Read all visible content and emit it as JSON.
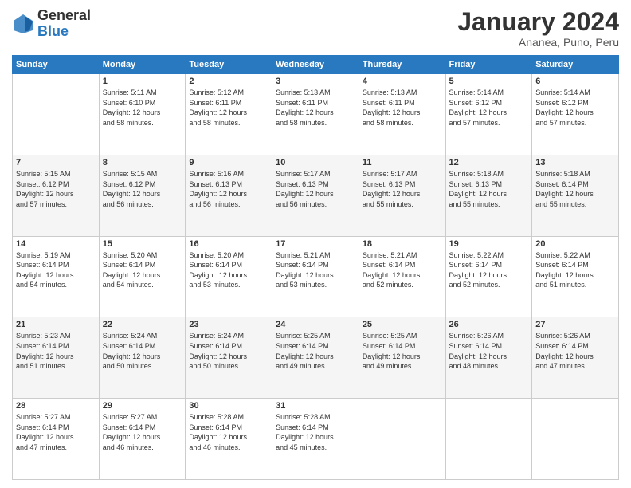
{
  "logo": {
    "general": "General",
    "blue": "Blue"
  },
  "title": {
    "month_year": "January 2024",
    "location": "Ananea, Puno, Peru"
  },
  "headers": [
    "Sunday",
    "Monday",
    "Tuesday",
    "Wednesday",
    "Thursday",
    "Friday",
    "Saturday"
  ],
  "weeks": [
    [
      {
        "num": "",
        "detail": ""
      },
      {
        "num": "1",
        "detail": "Sunrise: 5:11 AM\nSunset: 6:10 PM\nDaylight: 12 hours\nand 58 minutes."
      },
      {
        "num": "2",
        "detail": "Sunrise: 5:12 AM\nSunset: 6:11 PM\nDaylight: 12 hours\nand 58 minutes."
      },
      {
        "num": "3",
        "detail": "Sunrise: 5:13 AM\nSunset: 6:11 PM\nDaylight: 12 hours\nand 58 minutes."
      },
      {
        "num": "4",
        "detail": "Sunrise: 5:13 AM\nSunset: 6:11 PM\nDaylight: 12 hours\nand 58 minutes."
      },
      {
        "num": "5",
        "detail": "Sunrise: 5:14 AM\nSunset: 6:12 PM\nDaylight: 12 hours\nand 57 minutes."
      },
      {
        "num": "6",
        "detail": "Sunrise: 5:14 AM\nSunset: 6:12 PM\nDaylight: 12 hours\nand 57 minutes."
      }
    ],
    [
      {
        "num": "7",
        "detail": "Sunrise: 5:15 AM\nSunset: 6:12 PM\nDaylight: 12 hours\nand 57 minutes."
      },
      {
        "num": "8",
        "detail": "Sunrise: 5:15 AM\nSunset: 6:12 PM\nDaylight: 12 hours\nand 56 minutes."
      },
      {
        "num": "9",
        "detail": "Sunrise: 5:16 AM\nSunset: 6:13 PM\nDaylight: 12 hours\nand 56 minutes."
      },
      {
        "num": "10",
        "detail": "Sunrise: 5:17 AM\nSunset: 6:13 PM\nDaylight: 12 hours\nand 56 minutes."
      },
      {
        "num": "11",
        "detail": "Sunrise: 5:17 AM\nSunset: 6:13 PM\nDaylight: 12 hours\nand 55 minutes."
      },
      {
        "num": "12",
        "detail": "Sunrise: 5:18 AM\nSunset: 6:13 PM\nDaylight: 12 hours\nand 55 minutes."
      },
      {
        "num": "13",
        "detail": "Sunrise: 5:18 AM\nSunset: 6:14 PM\nDaylight: 12 hours\nand 55 minutes."
      }
    ],
    [
      {
        "num": "14",
        "detail": "Sunrise: 5:19 AM\nSunset: 6:14 PM\nDaylight: 12 hours\nand 54 minutes."
      },
      {
        "num": "15",
        "detail": "Sunrise: 5:20 AM\nSunset: 6:14 PM\nDaylight: 12 hours\nand 54 minutes."
      },
      {
        "num": "16",
        "detail": "Sunrise: 5:20 AM\nSunset: 6:14 PM\nDaylight: 12 hours\nand 53 minutes."
      },
      {
        "num": "17",
        "detail": "Sunrise: 5:21 AM\nSunset: 6:14 PM\nDaylight: 12 hours\nand 53 minutes."
      },
      {
        "num": "18",
        "detail": "Sunrise: 5:21 AM\nSunset: 6:14 PM\nDaylight: 12 hours\nand 52 minutes."
      },
      {
        "num": "19",
        "detail": "Sunrise: 5:22 AM\nSunset: 6:14 PM\nDaylight: 12 hours\nand 52 minutes."
      },
      {
        "num": "20",
        "detail": "Sunrise: 5:22 AM\nSunset: 6:14 PM\nDaylight: 12 hours\nand 51 minutes."
      }
    ],
    [
      {
        "num": "21",
        "detail": "Sunrise: 5:23 AM\nSunset: 6:14 PM\nDaylight: 12 hours\nand 51 minutes."
      },
      {
        "num": "22",
        "detail": "Sunrise: 5:24 AM\nSunset: 6:14 PM\nDaylight: 12 hours\nand 50 minutes."
      },
      {
        "num": "23",
        "detail": "Sunrise: 5:24 AM\nSunset: 6:14 PM\nDaylight: 12 hours\nand 50 minutes."
      },
      {
        "num": "24",
        "detail": "Sunrise: 5:25 AM\nSunset: 6:14 PM\nDaylight: 12 hours\nand 49 minutes."
      },
      {
        "num": "25",
        "detail": "Sunrise: 5:25 AM\nSunset: 6:14 PM\nDaylight: 12 hours\nand 49 minutes."
      },
      {
        "num": "26",
        "detail": "Sunrise: 5:26 AM\nSunset: 6:14 PM\nDaylight: 12 hours\nand 48 minutes."
      },
      {
        "num": "27",
        "detail": "Sunrise: 5:26 AM\nSunset: 6:14 PM\nDaylight: 12 hours\nand 47 minutes."
      }
    ],
    [
      {
        "num": "28",
        "detail": "Sunrise: 5:27 AM\nSunset: 6:14 PM\nDaylight: 12 hours\nand 47 minutes."
      },
      {
        "num": "29",
        "detail": "Sunrise: 5:27 AM\nSunset: 6:14 PM\nDaylight: 12 hours\nand 46 minutes."
      },
      {
        "num": "30",
        "detail": "Sunrise: 5:28 AM\nSunset: 6:14 PM\nDaylight: 12 hours\nand 46 minutes."
      },
      {
        "num": "31",
        "detail": "Sunrise: 5:28 AM\nSunset: 6:14 PM\nDaylight: 12 hours\nand 45 minutes."
      },
      {
        "num": "",
        "detail": ""
      },
      {
        "num": "",
        "detail": ""
      },
      {
        "num": "",
        "detail": ""
      }
    ]
  ]
}
